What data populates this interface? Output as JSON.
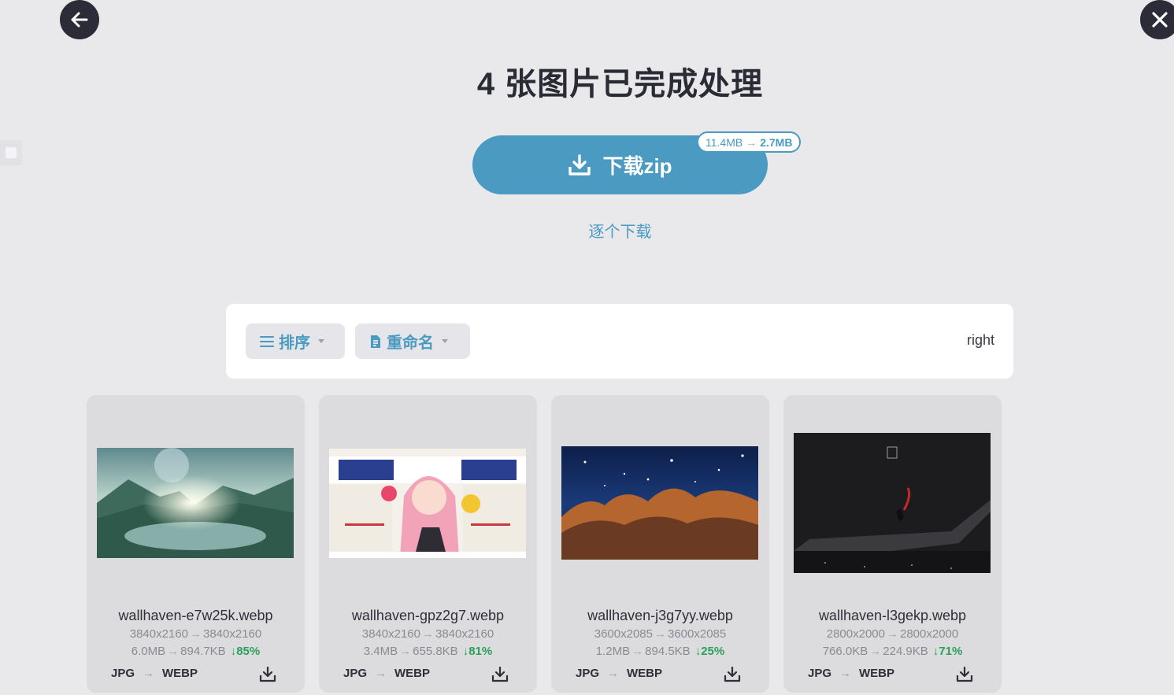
{
  "header": {
    "back_icon": "arrow-left-icon",
    "close_icon": "close-icon",
    "title": "4 张图片已完成处理"
  },
  "download": {
    "zip_label": "下载zip",
    "zip_icon": "download-icon",
    "badge_from": "11.4MB",
    "badge_to": "2.7MB",
    "each_label": "逐个下载"
  },
  "toolbar": {
    "sort_label": "排序",
    "sort_icon": "list-icon",
    "rename_label": "重命名",
    "rename_icon": "file-icon",
    "right_text": "right"
  },
  "colors": {
    "accent": "#4b9ac1",
    "dark": "#2c2c38",
    "success": "#2aa05a",
    "background": "#e9e9ec"
  },
  "files": [
    {
      "name": "wallhaven-e7w25k.webp",
      "dims_from": "3840x2160",
      "dims_to": "3840x2160",
      "size_from": "6.0MB",
      "size_to": "894.7KB",
      "saving": "85%",
      "format_from": "JPG",
      "format_to": "WEBP"
    },
    {
      "name": "wallhaven-gpz2g7.webp",
      "dims_from": "3840x2160",
      "dims_to": "3840x2160",
      "size_from": "3.4MB",
      "size_to": "655.8KB",
      "saving": "81%",
      "format_from": "JPG",
      "format_to": "WEBP"
    },
    {
      "name": "wallhaven-j3g7yy.webp",
      "dims_from": "3600x2085",
      "dims_to": "3600x2085",
      "size_from": "1.2MB",
      "size_to": "894.5KB",
      "saving": "25%",
      "format_from": "JPG",
      "format_to": "WEBP"
    },
    {
      "name": "wallhaven-l3gekp.webp",
      "dims_from": "2800x2000",
      "dims_to": "2800x2000",
      "size_from": "766.0KB",
      "size_to": "224.9KB",
      "saving": "71%",
      "format_from": "JPG",
      "format_to": "WEBP"
    }
  ]
}
